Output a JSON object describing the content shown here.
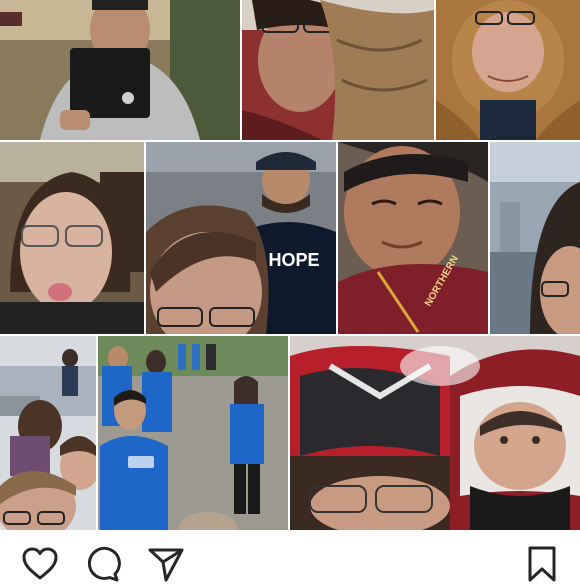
{
  "post": {
    "collage": {
      "photos": [
        {
          "name": "photo-airport-phone-selfie"
        },
        {
          "name": "photo-hood-selfie"
        },
        {
          "name": "photo-teddy-coat-selfie"
        },
        {
          "name": "photo-tongue-out-selfie"
        },
        {
          "name": "photo-crowd-selfie",
          "shirt_text": "HOPE"
        },
        {
          "name": "photo-red-shirt-selfie",
          "shirt_text": "NORTHERN"
        },
        {
          "name": "photo-airport-hall-selfie"
        },
        {
          "name": "photo-group-selfie"
        },
        {
          "name": "photo-blue-shirts-group"
        },
        {
          "name": "photo-helmet-selfie"
        }
      ]
    },
    "actions": {
      "like_icon": "heart-icon",
      "comment_icon": "comment-bubble-icon",
      "share_icon": "paper-plane-icon",
      "save_icon": "bookmark-icon"
    },
    "colors": {
      "icon": "#262626",
      "background": "#ffffff"
    }
  }
}
